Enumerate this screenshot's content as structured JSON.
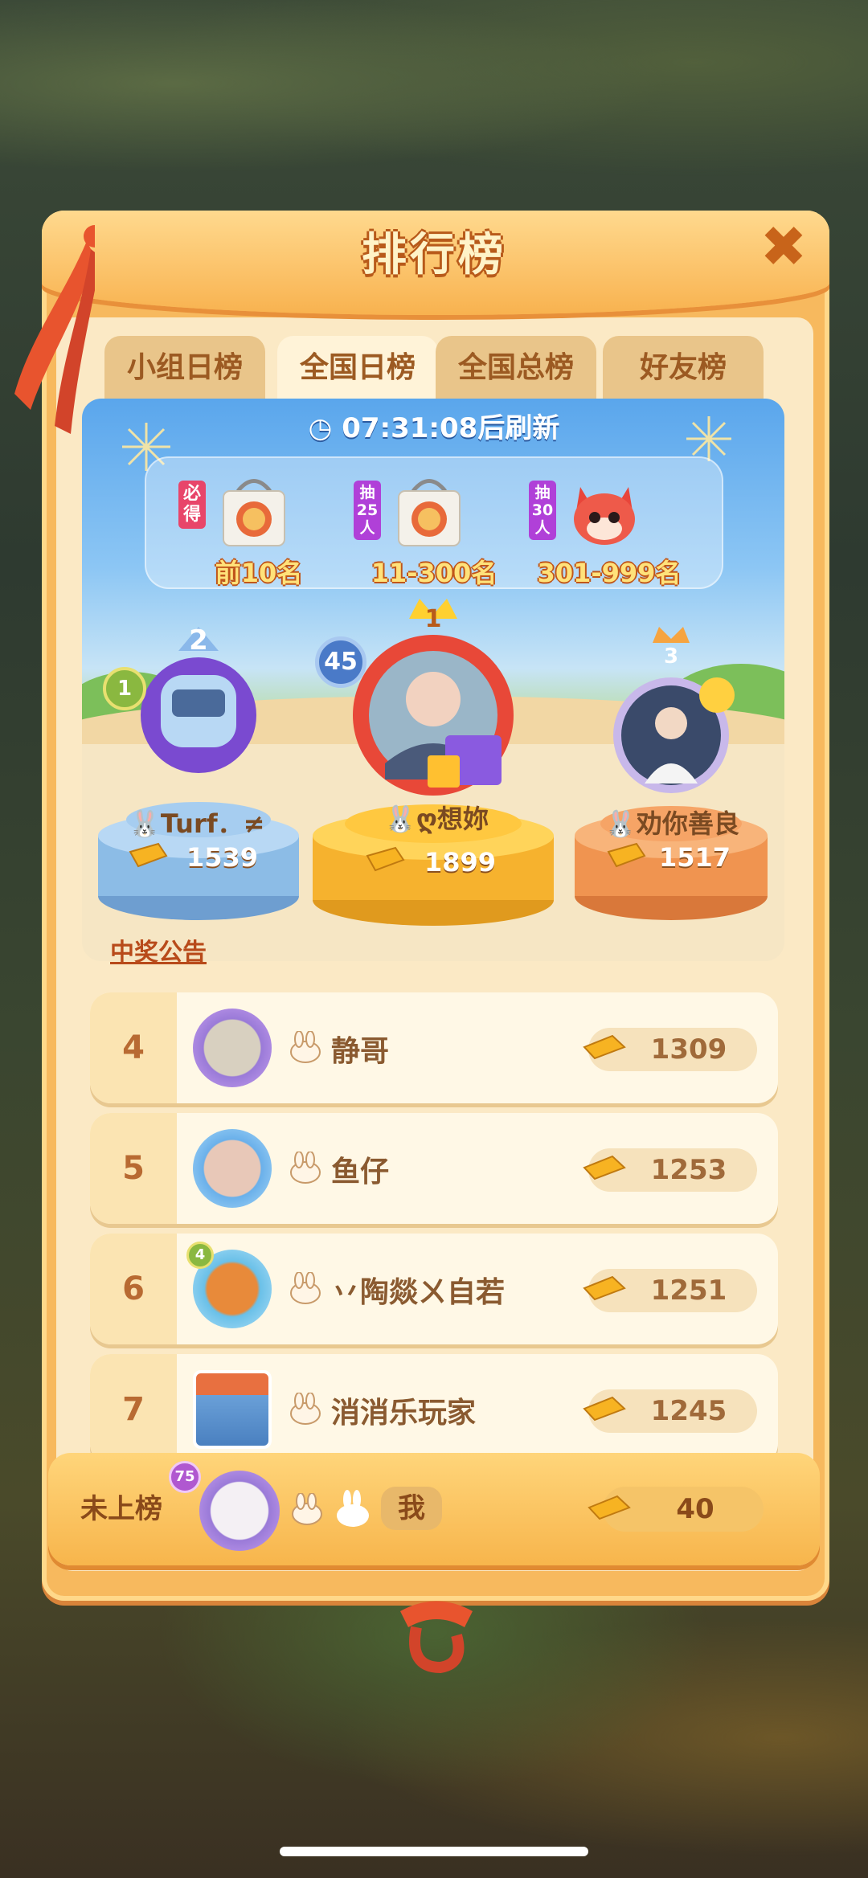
{
  "header": {
    "title": "排行榜",
    "close_glyph": "✖"
  },
  "tabs": [
    {
      "label": "小组日榜",
      "active": false
    },
    {
      "label": "全国日榜",
      "active": true
    },
    {
      "label": "全国总榜",
      "active": false
    },
    {
      "label": "好友榜",
      "active": false
    }
  ],
  "refresh": {
    "countdown": "07:31:08",
    "suffix": "后刷新",
    "icon": "clock-icon"
  },
  "rewards": [
    {
      "tag": "必得",
      "rank": "前10名",
      "prize_icon": "gift-bag-icon"
    },
    {
      "tag": "抽25人",
      "rank": "11-300名",
      "prize_icon": "gift-bag-icon"
    },
    {
      "tag": "抽30人",
      "rank": "301-999名",
      "prize_icon": "red-fox-plush-icon"
    }
  ],
  "podium": {
    "first": {
      "rank": "1",
      "level": "45",
      "name": "ღ想妳",
      "score": "1899"
    },
    "second": {
      "rank": "2",
      "level": "1",
      "name": "Turf．≠",
      "score": "1539"
    },
    "third": {
      "rank": "3",
      "name": "劝你善良",
      "score": "1517"
    }
  },
  "announcement_link": "中奖公告",
  "rows": [
    {
      "rank": "4",
      "name": "静哥",
      "score": "1309"
    },
    {
      "rank": "5",
      "name": "鱼仔",
      "score": "1253"
    },
    {
      "rank": "6",
      "name": "丷陶燚ㄨ自若",
      "score": "1251",
      "level": "4"
    },
    {
      "rank": "7",
      "name": "消消乐玩家",
      "score": "1245"
    }
  ],
  "me": {
    "status": "未上榜",
    "level": "75",
    "name": "我",
    "score": "40"
  },
  "colors": {
    "panel": "#f7b95e",
    "panel_inner": "#fbe9c5",
    "title_stroke": "#b85a1a",
    "gold_accent": "#f5c040"
  }
}
